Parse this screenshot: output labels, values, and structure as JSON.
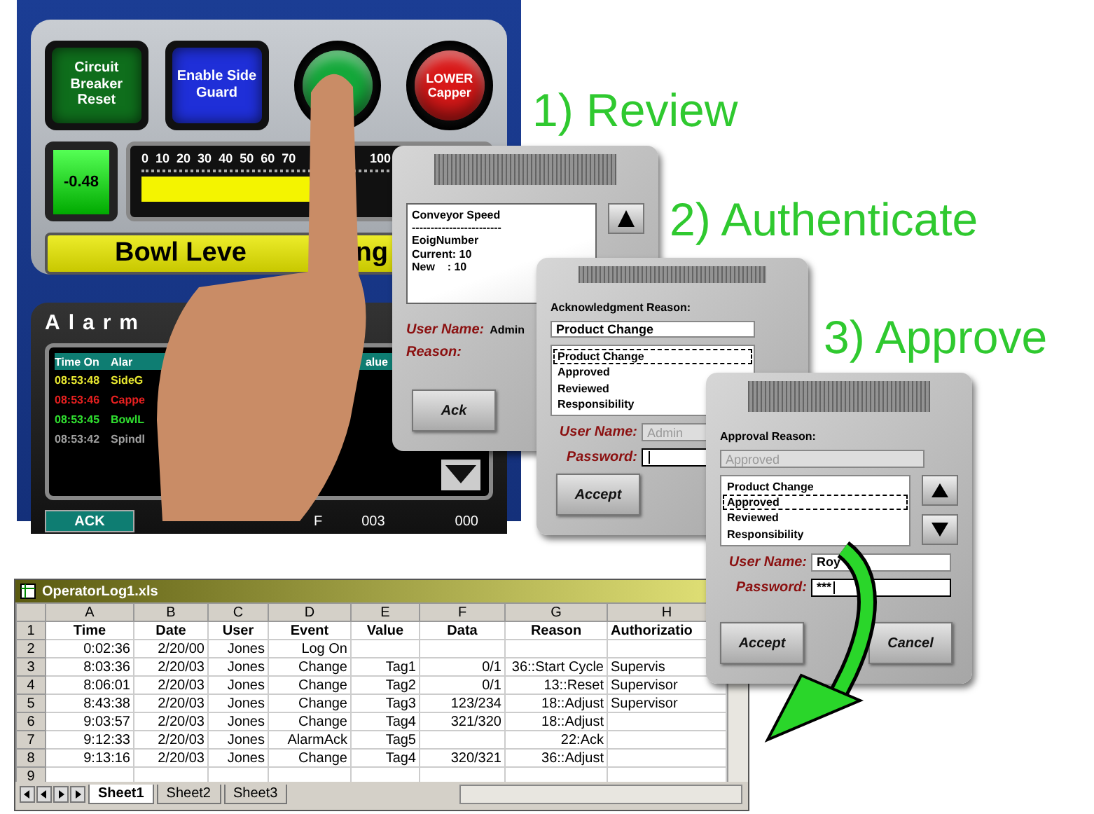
{
  "hmi": {
    "buttons": [
      {
        "kind": "square",
        "label": "Circuit Breaker Reset",
        "color": "#0f6e1c"
      },
      {
        "kind": "square",
        "label": "Enable Side Guard",
        "color": "#1f2fd8"
      },
      {
        "kind": "round",
        "color": "#14a83a"
      },
      {
        "kind": "round",
        "label": "LOWER Capper",
        "color": "#d81818"
      }
    ],
    "readout": "-0.48",
    "scale": [
      "0",
      "10",
      "20",
      "30",
      "40",
      "50",
      "60",
      "70",
      "100"
    ],
    "level": 0.5,
    "banner": [
      "Bowl Leve",
      "ng"
    ]
  },
  "alarm_panel": {
    "title": "Alarm",
    "columns": [
      "Time On",
      "Alar",
      "alue"
    ],
    "rows": [
      {
        "time": "08:53:48",
        "alarm": "SideG",
        "color": "#e8e830"
      },
      {
        "time": "08:53:46",
        "alarm": "Cappe",
        "color": "#e82020"
      },
      {
        "time": "08:53:45",
        "alarm": "BowlL",
        "color": "#30e030"
      },
      {
        "time": "08:53:42",
        "alarm": "Spindl",
        "color": "#a0a0a0"
      }
    ],
    "ack_button": "ACK",
    "footer": [
      "F",
      "003",
      "000"
    ]
  },
  "steps": [
    "1) Review",
    "2) Authenticate",
    "3) Approve"
  ],
  "dialogs": [
    {
      "kind": "review",
      "info": [
        "Conveyor Speed",
        "------------------------",
        "EoigNumber",
        "Current: 10",
        "New    : 10"
      ],
      "user_label": "User Name:",
      "user": "Admin",
      "reason_label": "Reason:",
      "buttons": [
        "Ack"
      ]
    },
    {
      "kind": "form",
      "heading": "Acknowledgment Reason:",
      "reason": {
        "value": "Product Change",
        "disabled": false
      },
      "list": [
        {
          "label": "Product Change",
          "selected": true
        },
        {
          "label": "Approved",
          "selected": false
        },
        {
          "label": "Reviewed",
          "selected": false
        },
        {
          "label": "Responsibility",
          "selected": false
        }
      ],
      "scroll_buttons": false,
      "user_label": "User Name:",
      "user": {
        "value": "Admin",
        "disabled": true
      },
      "password_label": "Password:",
      "password": {
        "focused": true
      },
      "buttons": [
        "Accept"
      ]
    },
    {
      "kind": "form",
      "heading": "Approval Reason:",
      "reason": {
        "value": "Approved",
        "disabled": true
      },
      "list": [
        {
          "label": "Product Change",
          "selected": false
        },
        {
          "label": "Approved",
          "selected": true
        },
        {
          "label": "Reviewed",
          "selected": false
        },
        {
          "label": "Responsibility",
          "selected": false
        }
      ],
      "scroll_buttons": true,
      "user_label": "User Name:",
      "user": {
        "value": "Roy",
        "disabled": false
      },
      "password_label": "Password:",
      "password": {
        "value": "***",
        "focused": true
      },
      "buttons": [
        "Accept",
        "Cancel"
      ]
    }
  ],
  "spreadsheet": {
    "title": "OperatorLog1.xls",
    "columns": [
      "A",
      "B",
      "C",
      "D",
      "E",
      "F",
      "G",
      "H"
    ],
    "row_labels": [
      "1",
      "2",
      "3",
      "4",
      "5",
      "6",
      "7",
      "8",
      "9"
    ],
    "rows": [
      [
        "Time",
        "Date",
        "User",
        "Event",
        "Value",
        "Data",
        "Reason",
        "Authorizatio"
      ],
      [
        "0:02:36",
        "2/20/00",
        "Jones",
        "Log On",
        null,
        null,
        null,
        null
      ],
      [
        "8:03:36",
        "2/20/03",
        "Jones",
        "Change",
        "Tag1",
        "0/1",
        "36::Start Cycle",
        "Supervis"
      ],
      [
        "8:06:01",
        "2/20/03",
        "Jones",
        "Change",
        "Tag2",
        "0/1",
        "13::Reset",
        "Supervisor"
      ],
      [
        "8:43:38",
        "2/20/03",
        "Jones",
        "Change",
        "Tag3",
        "123/234",
        "18::Adjust",
        "Supervisor"
      ],
      [
        "9:03:57",
        "2/20/03",
        "Jones",
        "Change",
        "Tag4",
        "321/320",
        "18::Adjust",
        null
      ],
      [
        "9:12:33",
        "2/20/03",
        "Jones",
        "AlarmAck",
        "Tag5",
        null,
        "22:Ack",
        null
      ],
      [
        "9:13:16",
        "2/20/03",
        "Jones",
        "Change",
        "Tag4",
        "320/321",
        "36::Adjust",
        null
      ],
      [
        null,
        null,
        null,
        null,
        null,
        null,
        null,
        null
      ]
    ],
    "sheets": [
      {
        "label": "Sheet1",
        "selected": true
      },
      {
        "label": "Sheet2",
        "selected": false
      },
      {
        "label": "Sheet3",
        "selected": false
      }
    ]
  }
}
